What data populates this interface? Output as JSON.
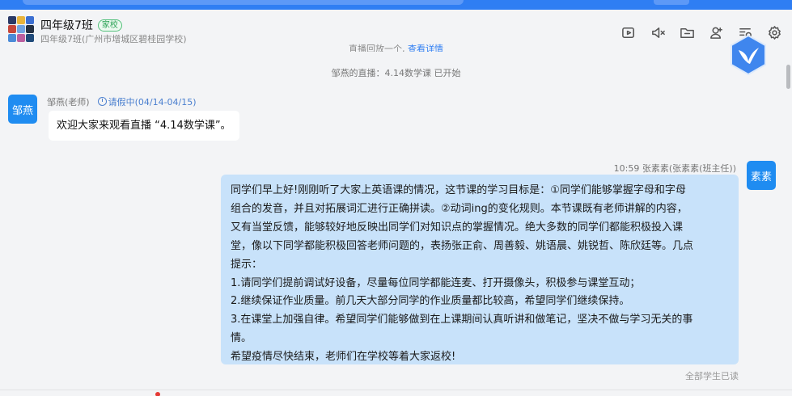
{
  "header": {
    "group_name": "四年级7班",
    "badge": "家校",
    "school": "四年级7班(广州市增城区碧桂园学校)",
    "avatar_colors": [
      "#2b3a67",
      "#e9b43a",
      "#3c6fd1",
      "#c7463a",
      "#6fa3e3",
      "#243042",
      "#4b8bd8",
      "#bc5fa0",
      "#1f4a7a"
    ],
    "icons": [
      "video-icon",
      "speaker-icon",
      "folder-icon",
      "add-member-icon",
      "search-list-icon",
      "settings-icon"
    ]
  },
  "messages": {
    "partial_prev": "直播回放一个,",
    "partial_link": "查看详情",
    "system": "邹燕的直播：4.14数学课 已开始",
    "first": {
      "avatar_text": "邹燕",
      "sender": "邹燕(老师)",
      "status": "请假中(04/14-04/15)",
      "text": "欢迎大家来观看直播 “4.14数学课”。"
    },
    "second": {
      "avatar_text": "素素",
      "meta": "10:59  张素素(张素素(班主任))",
      "lines": [
        "同学们早上好!刚刚听了大家上英语课的情况，这节课的学习目标是：①同学们能够掌握字母和字母",
        "组合的发音，并且对拓展词汇进行正确拼读。②动词ing的变化规则。本节课既有老师讲解的内容，",
        "又有当堂反馈，能够较好地反映出同学们对知识点的掌握情况。绝大多数的同学们都能积极投入课",
        "堂，像以下同学都能积极回答老师问题的，表扬张正俞、周善毅、姚语晨、姚锐哲、陈欣廷等。几点",
        "提示：",
        "1.请同学们提前调试好设备，尽量每位同学都能连麦、打开摄像头，积极参与课堂互动；",
        "2.继续保证作业质量。前几天大部分同学的作业质量都比较高，希望同学们继续保持。",
        "3.在课堂上加强自律。希望同学们能够做到在上课期间认真听讲和做笔记，坚决不做与学习无关的事",
        "情。",
        "希望疫情尽快结束，老师们在学校等着大家返校!"
      ],
      "read_status": "全部学生已读"
    }
  },
  "colors": {
    "accent": "#2f7ef3",
    "bubble_blue": "#c8e2fa",
    "avatar_blue": "#1f8cf1"
  }
}
